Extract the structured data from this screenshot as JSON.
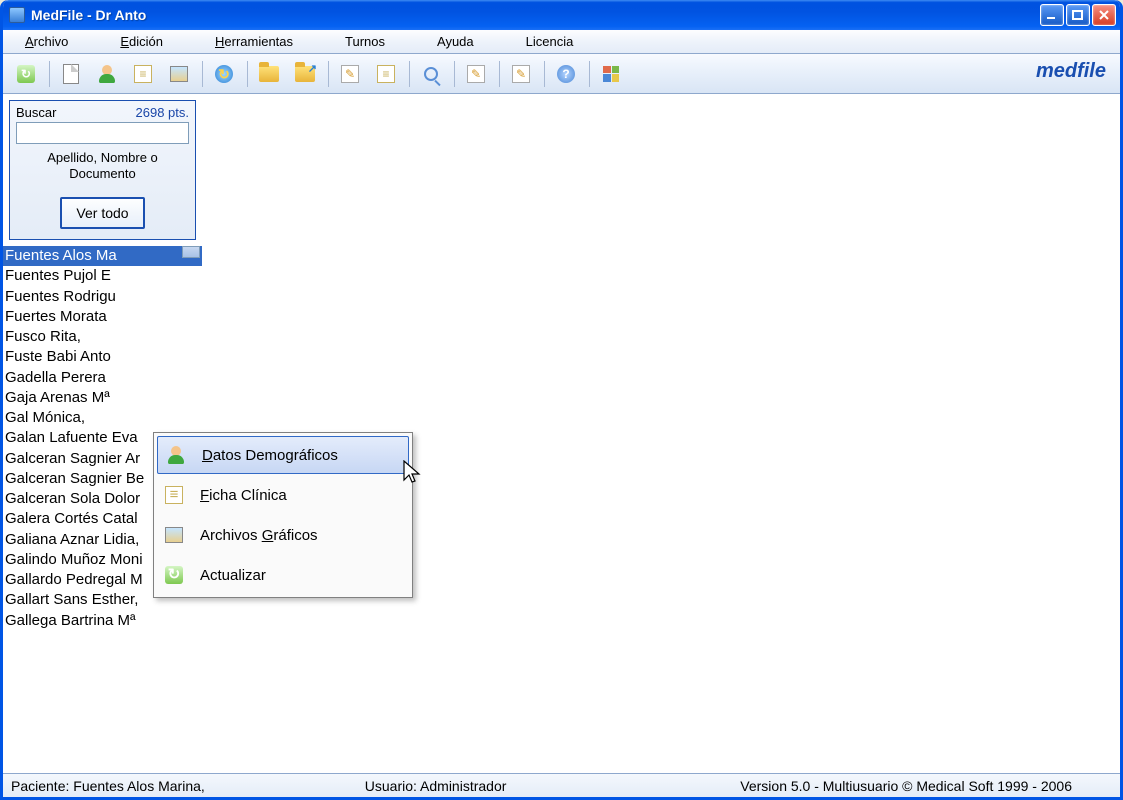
{
  "window": {
    "title": "MedFile - Dr Anto"
  },
  "menubar": {
    "archivo": "Archivo",
    "edicion": "Edición",
    "herramientas": "Herramientas",
    "turnos": "Turnos",
    "ayuda": "Ayuda",
    "licencia": "Licencia"
  },
  "brand": "medfile",
  "search": {
    "label": "Buscar",
    "count": "2698 pts.",
    "hint_l1": "Apellido, Nombre o",
    "hint_l2": "Documento",
    "ver_todo": "Ver todo"
  },
  "patients": [
    "Fuentes Alos Ma",
    "Fuentes Pujol E",
    "Fuentes Rodrigu",
    "Fuertes Morata",
    "Fusco Rita,",
    "Fuste Babi Anto",
    "Gadella Perera ",
    "Gaja Arenas Mª",
    "Gal Mónica,",
    "Galan Lafuente Eva",
    "Galceran Sagnier Ar",
    "Galceran Sagnier Be",
    "Galceran Sola Dolor",
    "Galera Cortés Catal",
    "Galiana Aznar Lidia,",
    "Galindo Muñoz Moni",
    "Gallardo Pedregal M",
    "Gallart Sans Esther,",
    "Gallega Bartrina Mª"
  ],
  "context_menu": {
    "datos": "atos Demográficos",
    "datos_ul": "D",
    "ficha": "icha Clínica",
    "ficha_ul": "F",
    "graficos_pre": "Archivos ",
    "graficos_ul": "G",
    "graficos_post": "ráficos",
    "actualizar": "Actualizar"
  },
  "statusbar": {
    "paciente_label": "Paciente: ",
    "paciente_value": "Fuentes Alos Marina,",
    "usuario_label": "Usuario: ",
    "usuario_value": "Administrador",
    "version": "Version 5.0 - Multiusuario  © Medical Soft 1999 - 2006"
  }
}
